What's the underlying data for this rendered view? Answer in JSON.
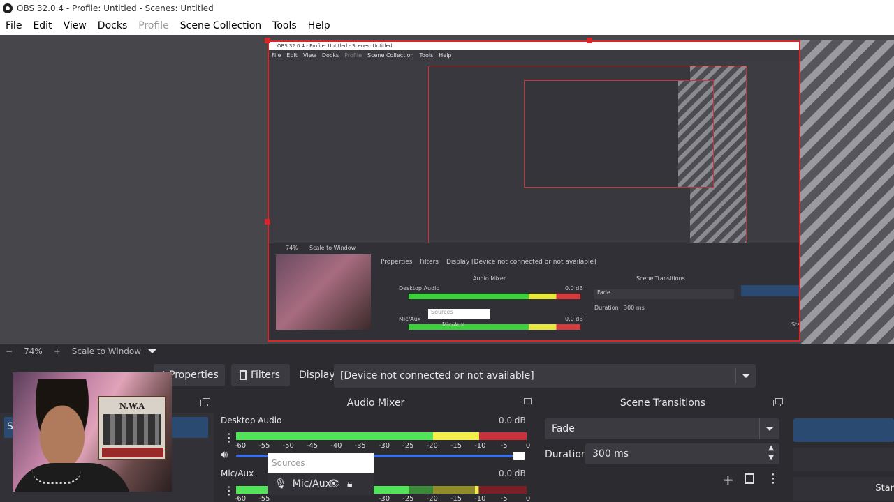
{
  "window": {
    "title": "OBS 32.0.4 - Profile: Untitled - Scenes: Untitled"
  },
  "menu": {
    "items": [
      "File",
      "Edit",
      "View",
      "Docks",
      "Profile",
      "Scene Collection",
      "Tools",
      "Help"
    ]
  },
  "mini": {
    "title": "OBS 32.0.4 - Profile: Untitled - Scenes: Untitled",
    "menu": [
      "File",
      "Edit",
      "View",
      "Docks",
      "Profile",
      "Scene Collection",
      "Tools",
      "Help"
    ],
    "zoom": "74%",
    "scale_mode": "Scale to Window",
    "properties": "Properties",
    "filters": "Filters",
    "display": "Display",
    "device": "[Device not connected or not available]",
    "audio_mixer": "Audio Mixer",
    "scene_transitions": "Scene Transitions",
    "desktop_audio": "Desktop Audio",
    "db": "0.0 dB",
    "mic": "Mic/Aux",
    "fade": "Fade",
    "duration_label": "Duration",
    "duration": "300 ms",
    "sources": "Sources",
    "start": "Star"
  },
  "zoom": {
    "minus": "−",
    "level": "74%",
    "plus": "+",
    "mode": "Scale to Window"
  },
  "toolbar": {
    "properties": "Properties",
    "filters": "Filters",
    "display_label": "Display",
    "display_value": "[Device not connected or not available]"
  },
  "audio_mixer": {
    "title": "Audio Mixer",
    "desktop": {
      "name": "Desktop Audio",
      "db": "0.0 dB",
      "level": 0.97
    },
    "mic": {
      "name": "Mic/Aux",
      "db": "0.0 dB",
      "level": 0.83
    },
    "scale": [
      "-60",
      "-55",
      "-50",
      "-45",
      "-40",
      "-35",
      "-30",
      "-25",
      "-20",
      "-15",
      "-10",
      "-5",
      "0"
    ],
    "scale_partial": [
      "-60",
      "-55",
      "-30",
      "-25",
      "-20",
      "-15",
      "-10",
      "-5",
      "0"
    ]
  },
  "scene_transitions": {
    "title": "Scene Transitions",
    "transition": "Fade",
    "duration_label": "Duration",
    "duration": "300 ms"
  },
  "sources_popup": {
    "placeholder": "Sources",
    "item": "Mic/Aux"
  },
  "left_dock": {
    "scene_initial": "S"
  },
  "controls": {
    "start": "Star"
  },
  "webcam_poster": {
    "title": "N.W.A"
  }
}
